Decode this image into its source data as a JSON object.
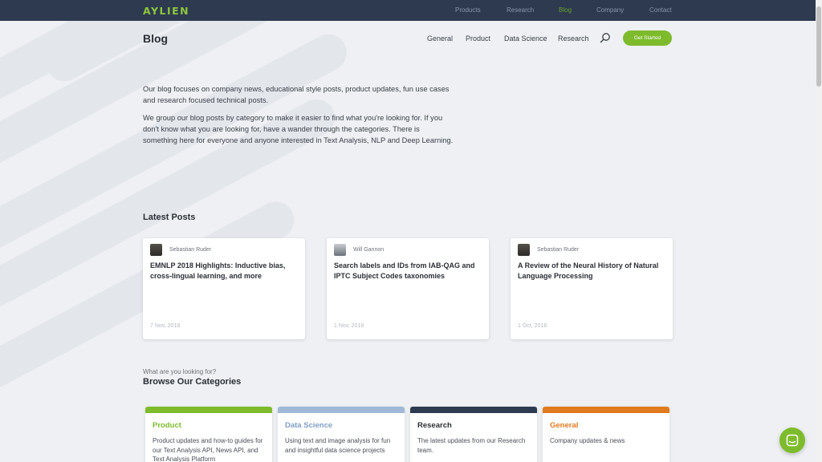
{
  "brand": {
    "logo": "AYLIEN",
    "accent": "#7dbb2c"
  },
  "topnav": {
    "items": [
      "Products",
      "Research",
      "Blog",
      "Company",
      "Contact"
    ],
    "active": "Blog"
  },
  "header": {
    "title": "Blog",
    "nav": [
      "General",
      "Product",
      "Data Science",
      "Research"
    ],
    "cta_label": "Get Started"
  },
  "intro": {
    "p1": "Our blog focuses on company news, educational style posts, product updates, fun use cases and research focused technical posts.",
    "p2": "We group our blog posts by category to make it easier to find what you're looking for. If you don't know what you are looking for, have a wander through the categories. There is something here for everyone and anyone interested in Text Analysis, NLP and Deep Learning."
  },
  "latest": {
    "heading": "Latest Posts",
    "posts": [
      {
        "author": "Sebastian Ruder",
        "title": "EMNLP 2018 Highlights: Inductive bias, cross-lingual learning, and more",
        "date": "7 Nov, 2018"
      },
      {
        "author": "Will Gannon",
        "title": "Search labels and IDs from IAB-QAG and IPTC Subject Codes taxonomies",
        "date": "1 Nov, 2018"
      },
      {
        "author": "Sebastian Ruder",
        "title": "A Review of the Neural History of Natural Language Processing",
        "date": "1 Oct, 2018"
      }
    ]
  },
  "categories": {
    "eyebrow": "What are you looking for?",
    "heading": "Browse Our Categories",
    "items": [
      {
        "name": "Product",
        "desc": "Product updates and how-to guides for our Text Analysis API, News API, and Text Analysis Platform",
        "color": "#7dbb2c",
        "title_color": "#7dbb2c"
      },
      {
        "name": "Data Science",
        "desc": "Using text and image analysis for fun and insightful data science projects",
        "color": "#9fb9d6",
        "title_color": "#7f9fc4"
      },
      {
        "name": "Research",
        "desc": "The latest updates from our Research team.",
        "color": "#2d3a50",
        "title_color": "#2b2f36"
      },
      {
        "name": "General",
        "desc": "Company updates & news",
        "color": "#e07a1f",
        "title_color": "#e07a1f"
      }
    ]
  }
}
